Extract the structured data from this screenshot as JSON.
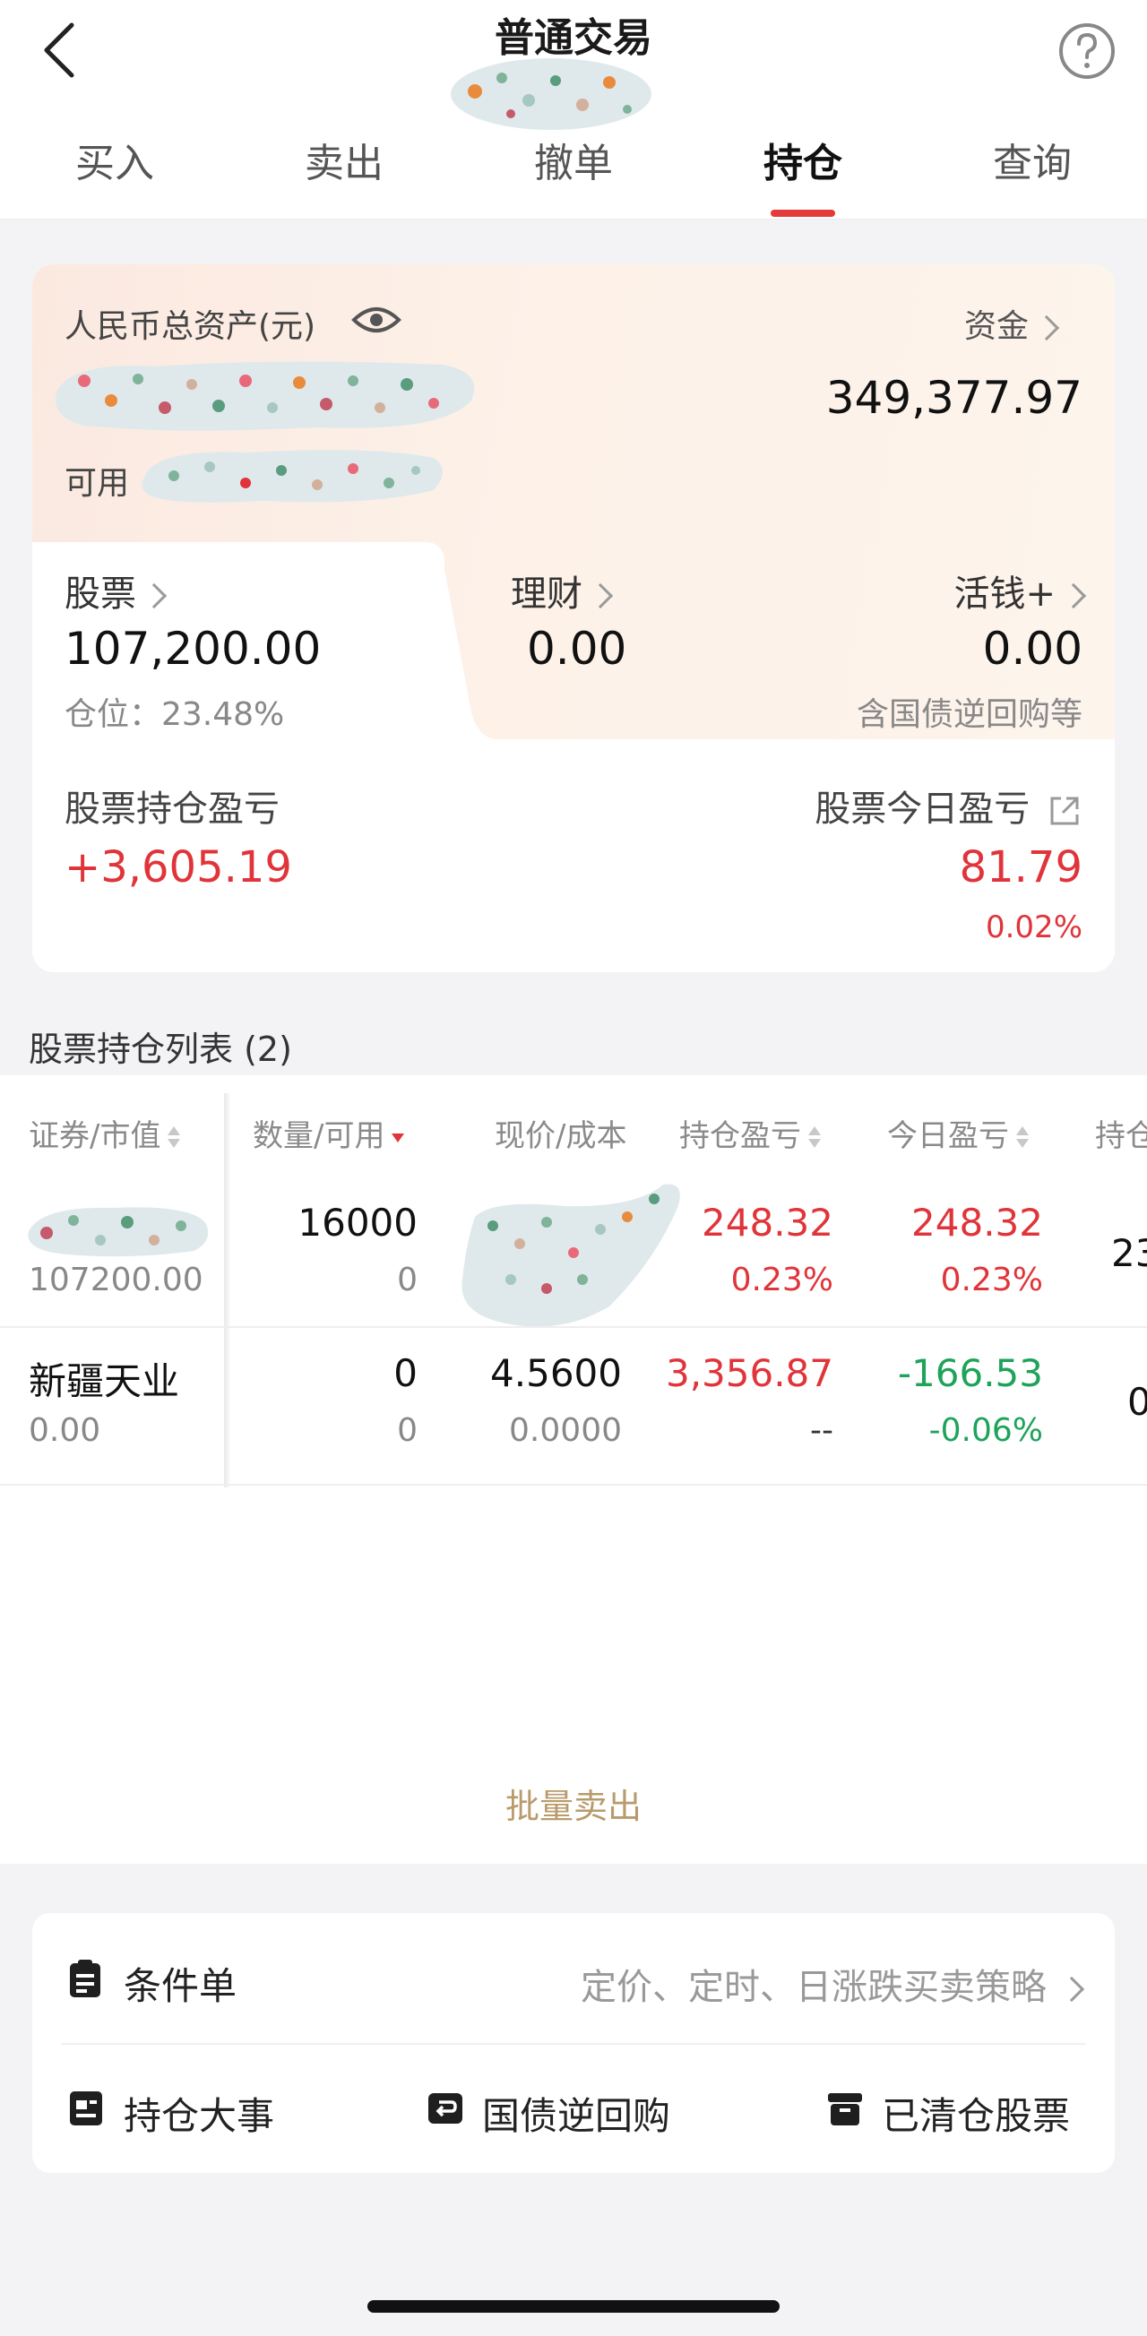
{
  "header": {
    "title": "普通交易",
    "tabs": [
      {
        "label": "买入",
        "active": false
      },
      {
        "label": "卖出",
        "active": false
      },
      {
        "label": "撤单",
        "active": false
      },
      {
        "label": "持仓",
        "active": true
      },
      {
        "label": "查询",
        "active": false
      }
    ]
  },
  "assets": {
    "total_label": "人民币总资产(元)",
    "funds_label": "资金",
    "funds_value": "349,377.97",
    "available_label": "可用",
    "stock_label": "股票",
    "stock_value": "107,200.00",
    "position_ratio": "仓位：23.48%",
    "wealth_label": "理财",
    "wealth_value": "0.00",
    "cash_plus_label": "活钱+",
    "cash_plus_value": "0.00",
    "cash_plus_note": "含国债逆回购等",
    "holding_pl_label": "股票持仓盈亏",
    "holding_pl_value": "+3,605.19",
    "today_pl_label": "股票今日盈亏",
    "today_pl_value": "81.79",
    "today_pl_pct": "0.02%"
  },
  "holdings": {
    "heading": "股票持仓列表 (2)",
    "columns": [
      "证券/市值",
      "数量/可用",
      "现价/成本",
      "持仓盈亏",
      "今日盈亏",
      "持仓"
    ],
    "rows": [
      {
        "name": "",
        "market_value": "107200.00",
        "quantity": "16000",
        "available": "0",
        "price": "",
        "cost": "",
        "holding_pl": "248.32",
        "holding_pl_pct": "0.23%",
        "today_pl": "248.32",
        "today_pl_pct": "0.23%",
        "position_partial": "23"
      },
      {
        "name": "新疆天业",
        "market_value": "0.00",
        "quantity": "0",
        "available": "0",
        "price": "4.5600",
        "cost": "0.0000",
        "holding_pl": "3,356.87",
        "holding_pl_pct": "--",
        "today_pl": "-166.53",
        "today_pl_pct": "-0.06%",
        "position_partial": "0"
      }
    ]
  },
  "batch_sell_label": "批量卖出",
  "tools": {
    "conditional_order_label": "条件单",
    "conditional_order_desc": "定价、定时、日涨跌买卖策略",
    "events_label": "持仓大事",
    "repo_label": "国债逆回购",
    "cleared_label": "已清仓股票"
  },
  "colors": {
    "accent_red": "#e0343a",
    "gain_green": "#1ea35a",
    "batch_gold": "#b99b6b",
    "card_gradient": "#fbe9e0"
  },
  "icons": [
    "back-arrow-icon",
    "help-icon",
    "eye-icon",
    "chevron-right-icon",
    "external-link-icon",
    "sort-icon",
    "clipboard-icon",
    "document-icon",
    "return-arrow-icon",
    "box-icon"
  ]
}
